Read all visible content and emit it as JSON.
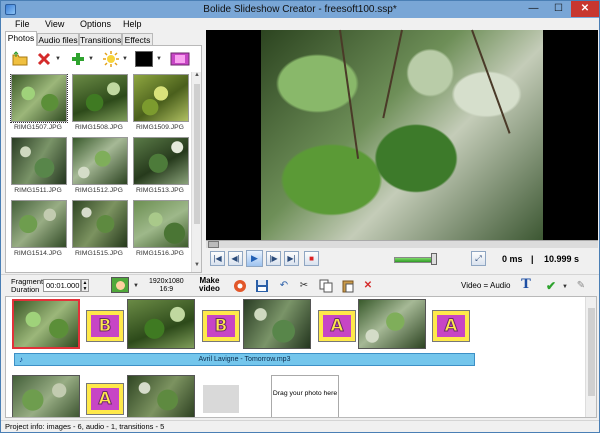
{
  "window": {
    "title": "Bolide Slideshow Creator - freesoft100.ssp*",
    "minimize_glyph": "—",
    "maximize_glyph": "☐",
    "close_glyph": "✕"
  },
  "menu": {
    "items": [
      "File",
      "View",
      "Options",
      "Help"
    ]
  },
  "left_tabs": [
    "Photos",
    "Audio files",
    "Transitions",
    "Effects"
  ],
  "photos": [
    {
      "label": "RIMG1507.JPG"
    },
    {
      "label": "RIMG1508.JPG"
    },
    {
      "label": "RIMG1509.JPG"
    },
    {
      "label": "RIMG1511.JPG"
    },
    {
      "label": "RIMG1512.JPG"
    },
    {
      "label": "RIMG1513.JPG"
    },
    {
      "label": "RIMG1514.JPG"
    },
    {
      "label": "RIMG1515.JPG"
    },
    {
      "label": "RIMG1516.JPG"
    }
  ],
  "player": {
    "time_current": "0 ms",
    "time_sep": "|",
    "time_total": "10.999 s",
    "volume_level": 0.88,
    "btn_first": "|◀",
    "btn_prev": "◀|",
    "btn_play": "▶",
    "btn_next": "|▶",
    "btn_last": "▶|",
    "btn_stop": "■",
    "btn_fullscreen": "⤢"
  },
  "mid_toolbar": {
    "fragment_label_1": "Fragment",
    "fragment_label_2": "Duration",
    "fragment_value": "00:01.000",
    "resolution_1": "1920x1080",
    "resolution_2": "16:9",
    "make_video_1": "Make",
    "make_video_2": "video",
    "video_audio": "Video = Audio",
    "text_glyph": "T"
  },
  "storyboard": {
    "row1_transitions": [
      "B",
      "B",
      "A",
      "A"
    ],
    "row2_transitions": [
      "A"
    ],
    "audio_track": "Avril Lavigne - Tomorrow.mp3",
    "audio_icon": "♪",
    "drag_hint": "Drag your photo here"
  },
  "status": {
    "text": "Project info: images - 6, audio - 1, transitions - 5"
  }
}
